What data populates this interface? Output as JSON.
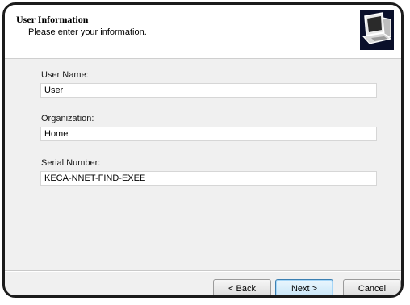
{
  "header": {
    "title": "User Information",
    "subtitle": "Please enter your information.",
    "icon": "computer-setup-icon"
  },
  "form": {
    "user_name": {
      "label": "User Name:",
      "value": "User"
    },
    "organization": {
      "label": "Organization:",
      "value": "Home"
    },
    "serial_number": {
      "label": "Serial Number:",
      "value": "KECA-NNET-FIND-EXEE"
    }
  },
  "buttons": {
    "back": "< Back",
    "next": "Next >",
    "cancel": "Cancel"
  },
  "colors": {
    "dialog_background": "#f0f0f0",
    "header_background": "#ffffff",
    "primary_button_border": "#3c7fb1"
  }
}
